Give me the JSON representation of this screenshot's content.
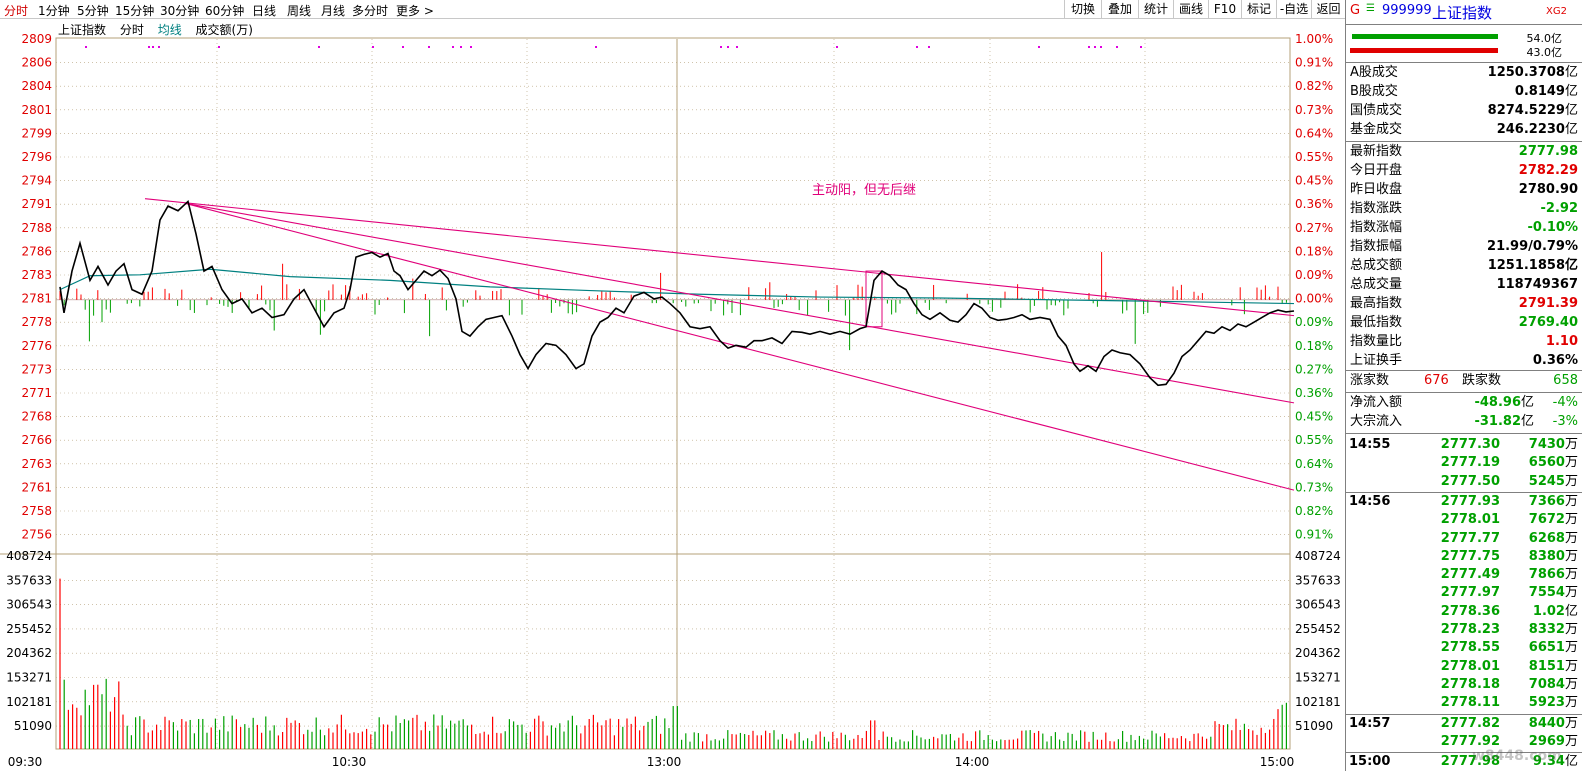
{
  "toolbar": {
    "left_items": [
      "分时",
      "1分钟",
      "5分钟",
      "15分钟",
      "30分钟",
      "60分钟",
      "日线",
      "周线",
      "月线",
      "多分时",
      "更多 >"
    ],
    "right_items": [
      "切换",
      "叠加",
      "统计",
      "画线",
      "F10",
      "标记",
      "-自选",
      "返回"
    ]
  },
  "chart_header": {
    "index_name": "上证指数",
    "tab_time": "分时",
    "tab_avg": "均线",
    "volume_label": "成交额(万)"
  },
  "annotation": "主动阳，但无后继",
  "price_axis": [
    "2809",
    "2806",
    "2804",
    "2801",
    "2799",
    "2796",
    "2794",
    "2791",
    "2788",
    "2786",
    "2783",
    "2781",
    "2778",
    "2776",
    "2773",
    "2771",
    "2768",
    "2766",
    "2763",
    "2761",
    "2758",
    "2756"
  ],
  "pct_axis": [
    "1.00%",
    "0.91%",
    "0.82%",
    "0.73%",
    "0.64%",
    "0.55%",
    "0.45%",
    "0.36%",
    "0.27%",
    "0.18%",
    "0.09%",
    "0.00%",
    "0.09%",
    "0.18%",
    "0.27%",
    "0.36%",
    "0.45%",
    "0.55%",
    "0.64%",
    "0.73%",
    "0.82%",
    "0.91%"
  ],
  "volume_axis": [
    "408724",
    "357633",
    "306543",
    "255452",
    "204362",
    "153271",
    "102181",
    "51090"
  ],
  "time_axis": [
    "09:30",
    "10:30",
    "13:00",
    "14:00",
    "15:00"
  ],
  "colors": {
    "up": "#ff0000",
    "down": "#00a000",
    "price_line": "#000000",
    "avg_line": "#008080",
    "trend_line": "#e0007a",
    "grid": "#b4a07a"
  },
  "chart_data": {
    "type": "line",
    "prev_close": 2780.9,
    "ylim": [
      2756,
      2809
    ],
    "price_series": [
      {
        "t": 0,
        "v": 2782.3
      },
      {
        "t": 4,
        "v": 2779.5
      },
      {
        "t": 12,
        "v": 2784
      },
      {
        "t": 20,
        "v": 2787
      },
      {
        "t": 30,
        "v": 2783
      },
      {
        "t": 38,
        "v": 2784.5
      },
      {
        "t": 48,
        "v": 2782.5
      },
      {
        "t": 56,
        "v": 2784
      },
      {
        "t": 64,
        "v": 2784.8
      },
      {
        "t": 72,
        "v": 2782
      },
      {
        "t": 82,
        "v": 2781.5
      },
      {
        "t": 92,
        "v": 2784
      },
      {
        "t": 100,
        "v": 2789.5
      },
      {
        "t": 108,
        "v": 2791
      },
      {
        "t": 118,
        "v": 2790.5
      },
      {
        "t": 128,
        "v": 2791.5
      },
      {
        "t": 136,
        "v": 2788
      },
      {
        "t": 144,
        "v": 2784
      },
      {
        "t": 152,
        "v": 2784.5
      },
      {
        "t": 162,
        "v": 2782
      },
      {
        "t": 172,
        "v": 2780.5
      },
      {
        "t": 182,
        "v": 2781
      },
      {
        "t": 192,
        "v": 2779.5
      },
      {
        "t": 202,
        "v": 2780
      },
      {
        "t": 212,
        "v": 2779
      },
      {
        "t": 224,
        "v": 2779.3
      },
      {
        "t": 234,
        "v": 2781
      },
      {
        "t": 244,
        "v": 2782
      },
      {
        "t": 254,
        "v": 2780
      },
      {
        "t": 264,
        "v": 2778
      },
      {
        "t": 274,
        "v": 2779.5
      },
      {
        "t": 284,
        "v": 2780
      },
      {
        "t": 290,
        "v": 2782
      },
      {
        "t": 296,
        "v": 2785.5
      },
      {
        "t": 304,
        "v": 2785.8
      },
      {
        "t": 312,
        "v": 2786
      },
      {
        "t": 320,
        "v": 2785.5
      },
      {
        "t": 328,
        "v": 2785.9
      },
      {
        "t": 334,
        "v": 2784
      },
      {
        "t": 340,
        "v": 2783.5
      },
      {
        "t": 348,
        "v": 2782
      },
      {
        "t": 356,
        "v": 2783
      },
      {
        "t": 364,
        "v": 2784
      },
      {
        "t": 372,
        "v": 2783.5
      },
      {
        "t": 380,
        "v": 2784.1
      },
      {
        "t": 388,
        "v": 2783.2
      },
      {
        "t": 396,
        "v": 2781
      },
      {
        "t": 402,
        "v": 2777.5
      },
      {
        "t": 410,
        "v": 2777
      },
      {
        "t": 418,
        "v": 2778
      },
      {
        "t": 426,
        "v": 2778.8
      },
      {
        "t": 434,
        "v": 2779
      },
      {
        "t": 442,
        "v": 2779.2
      },
      {
        "t": 452,
        "v": 2777
      },
      {
        "t": 460,
        "v": 2775
      },
      {
        "t": 468,
        "v": 2773.5
      },
      {
        "t": 476,
        "v": 2775
      },
      {
        "t": 486,
        "v": 2776.2
      },
      {
        "t": 496,
        "v": 2776
      },
      {
        "t": 506,
        "v": 2775
      },
      {
        "t": 516,
        "v": 2773.5
      },
      {
        "t": 524,
        "v": 2774
      },
      {
        "t": 532,
        "v": 2777
      },
      {
        "t": 540,
        "v": 2778.5
      },
      {
        "t": 548,
        "v": 2779
      },
      {
        "t": 556,
        "v": 2780
      },
      {
        "t": 564,
        "v": 2779.5
      },
      {
        "t": 574,
        "v": 2781.3
      },
      {
        "t": 584,
        "v": 2781.7
      },
      {
        "t": 594,
        "v": 2781
      },
      {
        "t": 602,
        "v": 2781.2
      },
      {
        "t": 610,
        "v": 2780.5
      },
      {
        "t": 620,
        "v": 2779.5
      },
      {
        "t": 630,
        "v": 2778
      },
      {
        "t": 640,
        "v": 2777.8
      },
      {
        "t": 650,
        "v": 2778
      },
      {
        "t": 660,
        "v": 2776.5
      },
      {
        "t": 668,
        "v": 2775.7
      },
      {
        "t": 676,
        "v": 2776
      },
      {
        "t": 686,
        "v": 2775.8
      },
      {
        "t": 694,
        "v": 2776.5
      },
      {
        "t": 702,
        "v": 2776.5
      },
      {
        "t": 712,
        "v": 2776.8
      },
      {
        "t": 722,
        "v": 2776.2
      },
      {
        "t": 732,
        "v": 2777.5
      },
      {
        "t": 742,
        "v": 2777.4
      },
      {
        "t": 750,
        "v": 2777.2
      },
      {
        "t": 760,
        "v": 2777.5
      },
      {
        "t": 770,
        "v": 2777.2
      },
      {
        "t": 780,
        "v": 2777.5
      },
      {
        "t": 790,
        "v": 2777.2
      },
      {
        "t": 800,
        "v": 2777.8
      },
      {
        "t": 806,
        "v": 2778
      },
      {
        "t": 814,
        "v": 2783
      },
      {
        "t": 822,
        "v": 2784
      },
      {
        "t": 830,
        "v": 2783.5
      },
      {
        "t": 838,
        "v": 2782.5
      },
      {
        "t": 846,
        "v": 2782
      },
      {
        "t": 854,
        "v": 2780.5
      },
      {
        "t": 862,
        "v": 2779.3
      },
      {
        "t": 870,
        "v": 2778.8
      },
      {
        "t": 880,
        "v": 2779.5
      },
      {
        "t": 890,
        "v": 2778.7
      },
      {
        "t": 898,
        "v": 2778.5
      },
      {
        "t": 906,
        "v": 2779.3
      },
      {
        "t": 914,
        "v": 2780.5
      },
      {
        "t": 922,
        "v": 2780
      },
      {
        "t": 930,
        "v": 2779
      },
      {
        "t": 938,
        "v": 2778.7
      },
      {
        "t": 946,
        "v": 2778.8
      },
      {
        "t": 954,
        "v": 2779
      },
      {
        "t": 962,
        "v": 2779.3
      },
      {
        "t": 970,
        "v": 2778.8
      },
      {
        "t": 980,
        "v": 2779
      },
      {
        "t": 990,
        "v": 2778.8
      },
      {
        "t": 998,
        "v": 2777
      },
      {
        "t": 1006,
        "v": 2776
      },
      {
        "t": 1014,
        "v": 2774
      },
      {
        "t": 1020,
        "v": 2773.2
      },
      {
        "t": 1028,
        "v": 2773.8
      },
      {
        "t": 1036,
        "v": 2773.2
      },
      {
        "t": 1044,
        "v": 2774.8
      },
      {
        "t": 1052,
        "v": 2775.5
      },
      {
        "t": 1060,
        "v": 2775.2
      },
      {
        "t": 1070,
        "v": 2775
      },
      {
        "t": 1080,
        "v": 2774
      },
      {
        "t": 1090,
        "v": 2772.5
      },
      {
        "t": 1098,
        "v": 2771.7
      },
      {
        "t": 1106,
        "v": 2771.8
      },
      {
        "t": 1114,
        "v": 2773
      },
      {
        "t": 1122,
        "v": 2774.8
      },
      {
        "t": 1130,
        "v": 2775.5
      },
      {
        "t": 1138,
        "v": 2776.5
      },
      {
        "t": 1146,
        "v": 2777.5
      },
      {
        "t": 1154,
        "v": 2777.3
      },
      {
        "t": 1162,
        "v": 2778
      },
      {
        "t": 1170,
        "v": 2777.6
      },
      {
        "t": 1178,
        "v": 2778.3
      },
      {
        "t": 1186,
        "v": 2778
      },
      {
        "t": 1194,
        "v": 2778.5
      },
      {
        "t": 1202,
        "v": 2779
      },
      {
        "t": 1210,
        "v": 2779.5
      },
      {
        "t": 1218,
        "v": 2779.8
      },
      {
        "t": 1226,
        "v": 2779.6
      },
      {
        "t": 1234,
        "v": 2779.7
      }
    ],
    "avg_series": [
      {
        "t": 0,
        "v": 2782
      },
      {
        "t": 30,
        "v": 2783.5
      },
      {
        "t": 80,
        "v": 2783.6
      },
      {
        "t": 150,
        "v": 2784.2
      },
      {
        "t": 230,
        "v": 2783.4
      },
      {
        "t": 330,
        "v": 2783
      },
      {
        "t": 430,
        "v": 2782.3
      },
      {
        "t": 530,
        "v": 2781.9
      },
      {
        "t": 640,
        "v": 2781.5
      },
      {
        "t": 760,
        "v": 2781.2
      },
      {
        "t": 880,
        "v": 2781.1
      },
      {
        "t": 1000,
        "v": 2780.9
      },
      {
        "t": 1120,
        "v": 2780.7
      },
      {
        "t": 1234,
        "v": 2780.5
      }
    ],
    "trend_lines": [
      {
        "from": {
          "t": 85,
          "v": 2791.8
        },
        "to": {
          "t": 1234,
          "v": 2779.2
        }
      },
      {
        "from": {
          "t": 125,
          "v": 2791.3
        },
        "to": {
          "t": 1234,
          "v": 2769.8
        }
      },
      {
        "from": {
          "t": 125,
          "v": 2791.3
        },
        "to": {
          "t": 1234,
          "v": 2760.4
        }
      }
    ],
    "high": 2791.39,
    "low": 2769.4,
    "volume_ylim": [
      0,
      408724
    ],
    "volume_time_axis": [
      "09:30",
      "10:30",
      "13:00",
      "14:00",
      "15:00"
    ]
  },
  "panel": {
    "header": {
      "g": "G",
      "code": "999999",
      "name": "上证指数",
      "tag": "XG2"
    },
    "ratio_top": "54.0亿",
    "ratio_bottom": "43.0亿",
    "market": [
      {
        "label": "A股成交",
        "value": "1250.3708",
        "unit": "亿"
      },
      {
        "label": "B股成交",
        "value": "0.8149",
        "unit": "亿"
      },
      {
        "label": "国债成交",
        "value": "8274.5229",
        "unit": "亿"
      },
      {
        "label": "基金成交",
        "value": "246.2230",
        "unit": "亿"
      }
    ],
    "stats": [
      {
        "label": "最新指数",
        "value": "2777.98",
        "color": "green"
      },
      {
        "label": "今日开盘",
        "value": "2782.29",
        "color": "red"
      },
      {
        "label": "昨日收盘",
        "value": "2780.90",
        "color": "black"
      },
      {
        "label": "指数涨跌",
        "value": "-2.92",
        "color": "green"
      },
      {
        "label": "指数涨幅",
        "value": "-0.10%",
        "color": "green"
      },
      {
        "label": "指数振幅",
        "value": "21.99/0.79%",
        "color": "black"
      },
      {
        "label": "总成交额",
        "value": "1251.1858亿",
        "color": "black"
      },
      {
        "label": "总成交量",
        "value": "118749367",
        "color": "black"
      },
      {
        "label": "最高指数",
        "value": "2791.39",
        "color": "red"
      },
      {
        "label": "最低指数",
        "value": "2769.40",
        "color": "green"
      },
      {
        "label": "指数量比",
        "value": "1.10",
        "color": "red"
      },
      {
        "label": "上证换手",
        "value": "0.36%",
        "color": "black"
      }
    ],
    "breadth": {
      "up_label": "涨家数",
      "up_value": "676",
      "down_label": "跌家数",
      "down_value": "658"
    },
    "flows": [
      {
        "label": "净流入额",
        "value": "-48.96",
        "unit": "亿",
        "pct": "-4%"
      },
      {
        "label": "大宗流入",
        "value": "-31.82",
        "unit": "亿",
        "pct": "-3%"
      }
    ],
    "ticks": [
      {
        "time": "14:55",
        "price": "2777.30",
        "vol": "7430",
        "unit": "万"
      },
      {
        "time": "",
        "price": "2777.19",
        "vol": "6560",
        "unit": "万"
      },
      {
        "time": "",
        "price": "2777.50",
        "vol": "5245",
        "unit": "万"
      },
      {
        "time": "14:56",
        "price": "2777.93",
        "vol": "7366",
        "unit": "万"
      },
      {
        "time": "",
        "price": "2778.01",
        "vol": "7672",
        "unit": "万"
      },
      {
        "time": "",
        "price": "2777.77",
        "vol": "6268",
        "unit": "万"
      },
      {
        "time": "",
        "price": "2777.75",
        "vol": "8380",
        "unit": "万"
      },
      {
        "time": "",
        "price": "2777.49",
        "vol": "7866",
        "unit": "万"
      },
      {
        "time": "",
        "price": "2777.97",
        "vol": "7554",
        "unit": "万"
      },
      {
        "time": "",
        "price": "2778.36",
        "vol": "1.02",
        "unit": "亿"
      },
      {
        "time": "",
        "price": "2778.23",
        "vol": "8332",
        "unit": "万"
      },
      {
        "time": "",
        "price": "2778.55",
        "vol": "6651",
        "unit": "万"
      },
      {
        "time": "",
        "price": "2778.01",
        "vol": "8151",
        "unit": "万"
      },
      {
        "time": "",
        "price": "2778.18",
        "vol": "7084",
        "unit": "万"
      },
      {
        "time": "",
        "price": "2778.11",
        "vol": "5923",
        "unit": "万"
      },
      {
        "time": "14:57",
        "price": "2777.82",
        "vol": "8440",
        "unit": "万"
      },
      {
        "time": "",
        "price": "2777.92",
        "vol": "2969",
        "unit": "万"
      },
      {
        "time": "15:00",
        "price": "2777.98",
        "vol": "9.34",
        "unit": "亿"
      }
    ],
    "watermark": "w8448.com"
  }
}
